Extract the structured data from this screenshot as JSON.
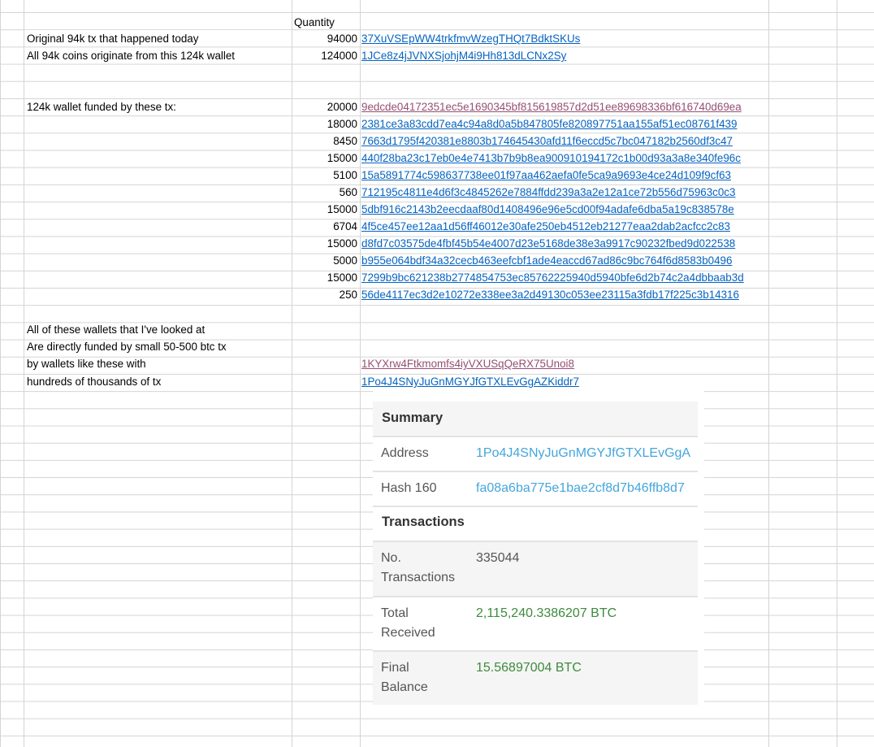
{
  "sheet": {
    "quantity_header": "Quantity",
    "rows_top": [
      {
        "label": "Original 94k tx that happened today",
        "qty": "94000",
        "link": "37XuVSEpWW4trkfmvWzegTHQt7BdktSKUs"
      },
      {
        "label": "All 94k coins originate from this 124k wallet",
        "qty": "124000",
        "link": "1JCe8z4jJVNXSjohjM4i9Hh813dLCNx2Sy"
      }
    ],
    "funded_label": "124k wallet funded by these tx:",
    "funding_tx": [
      {
        "qty": "20000",
        "tx": "9edcde04172351ec5e1690345bf815619857d2d51ee89698336bf616740d69ea"
      },
      {
        "qty": "18000",
        "tx": "2381ce3a83cdd7ea4c94a8d0a5b847805fe820897751aa155af51ec08761f439"
      },
      {
        "qty": "8450",
        "tx": "7663d1795f420381e8803b174645430afd11f6eccd5c7bc047182b2560df3c47"
      },
      {
        "qty": "15000",
        "tx": "440f28ba23c17eb0e4e7413b7b9b8ea900910194172c1b00d93a3a8e340fe96c"
      },
      {
        "qty": "5100",
        "tx": "15a5891774c598637738ee01f97aa462aefa0fe5ca9a9693e4ce24d109f9cf63"
      },
      {
        "qty": "560",
        "tx": "712195c4811e4d6f3c4845262e7884ffdd239a3a2e12a1ce72b556d75963c0c3"
      },
      {
        "qty": "15000",
        "tx": "5dbf916c2143b2eecdaaf80d1408496e96e5cd00f94adafe6dba5a19c838578e"
      },
      {
        "qty": "6704",
        "tx": "4f5ce457ee12aa1d56ff46012e30afe250eb4512eb21277eaa2dab2acfcc2c83"
      },
      {
        "qty": "15000",
        "tx": "d8fd7c03575de4fbf45b54e4007d23e5168de38e3a9917c90232fbed9d022538"
      },
      {
        "qty": "5000",
        "tx": "b955e064bdf34a32cecb463eefcbf1ade4eaccd67ad86c9bc764f6d8583b0496"
      },
      {
        "qty": "15000",
        "tx": "7299b9bc621238b2774854753ec85762225940d5940bfe6d2b74c2a4dbbaab3d"
      },
      {
        "qty": "250",
        "tx": "56de4117ec3d2e10272e338ee3a2d49130c053ee23115a3fdb17f225c3b14316"
      }
    ],
    "note_lines": [
      "All of these wallets that I've looked at",
      "Are directly funded by small 50-500 btc tx",
      "by wallets like these with",
      "hundreds of thousands of tx"
    ],
    "example_wallets": [
      "1KYXrw4Ftkmomfs4iyVXUSqQeRX75Unoi8",
      "1Po4J4SNyJuGnMGYJfGTXLEvGgAZKiddr7"
    ]
  },
  "summary": {
    "summary_title": "Summary",
    "address_label": "Address",
    "address_value": "1Po4J4SNyJuGnMGYJfGTXLEvGgA",
    "hash_label": "Hash 160",
    "hash_value": "fa08a6ba775e1bae2cf8d7b46ffb8d7",
    "transactions_title": "Transactions",
    "no_tx_label_1": "No.",
    "no_tx_label_2": "Transactions",
    "no_tx_value": "335044",
    "total_label_1": "Total",
    "total_label_2": "Received",
    "total_value": "2,115,240.3386207 BTC",
    "final_label_1": "Final",
    "final_label_2": "Balance",
    "final_value": "15.56897004 BTC",
    "colors": {
      "link_blue": "#45a6dc",
      "value_green": "#3d8b3d",
      "header_bg": "#f5f5f5"
    }
  }
}
